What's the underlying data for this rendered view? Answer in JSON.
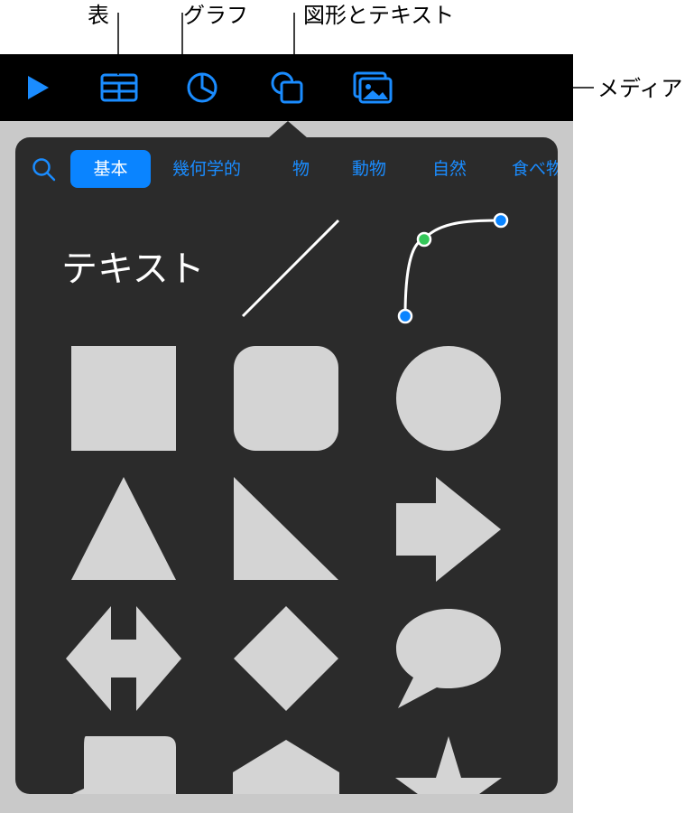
{
  "callouts": {
    "table": "表",
    "chart": "グラフ",
    "shapes_text": "図形とテキスト",
    "media": "メディア"
  },
  "toolbar": {
    "icons": [
      "play-icon",
      "table-icon",
      "chart-icon",
      "shape-icon",
      "media-icon"
    ],
    "accent": "#1a8cff"
  },
  "popover": {
    "tabs": [
      {
        "label": "基本",
        "active": true
      },
      {
        "label": "幾何学的",
        "active": false
      },
      {
        "label": "物",
        "active": false
      },
      {
        "label": "動物",
        "active": false
      },
      {
        "label": "自然",
        "active": false
      },
      {
        "label": "食べ物",
        "active": false
      }
    ],
    "text_shape_label": "テキスト",
    "shapes": [
      "text",
      "line",
      "curve",
      "square",
      "rounded-square",
      "circle",
      "triangle",
      "right-triangle",
      "arrow",
      "double-arrow",
      "diamond",
      "speech-bubble",
      "callout-square",
      "pentagon",
      "star"
    ],
    "shape_color": "#d4d4d4",
    "background": "#2b2b2b"
  }
}
